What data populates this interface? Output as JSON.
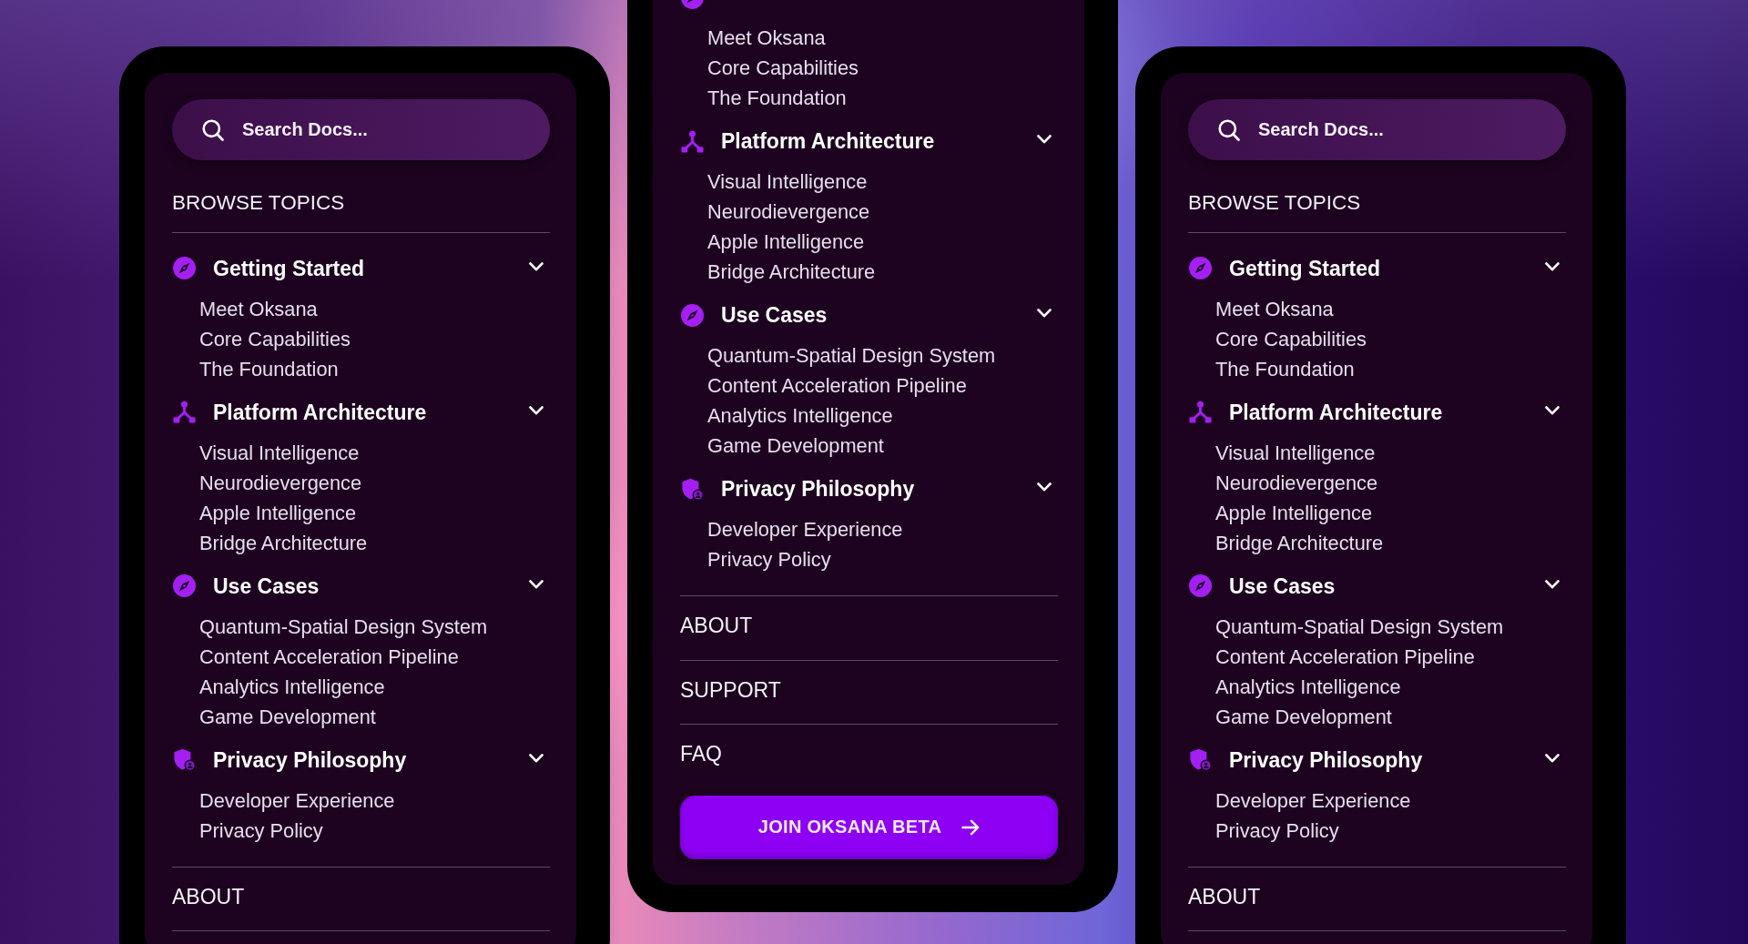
{
  "phones": [
    {
      "search": {
        "placeholder": "Search Docs..."
      },
      "section_title": "BROWSE TOPICS",
      "topics": [
        {
          "kind": "compass",
          "label": "Getting Started",
          "items": [
            "Meet Oksana",
            "Core Capabilities",
            "The Foundation"
          ]
        },
        {
          "kind": "network",
          "label": "Platform Architecture",
          "items": [
            "Visual Intelligence",
            "Neurodievergence",
            "Apple Intelligence",
            "Bridge Architecture"
          ]
        },
        {
          "kind": "compass",
          "label": "Use Cases",
          "items": [
            "Quantum-Spatial Design System",
            "Content Acceleration Pipeline",
            "Analytics Intelligence",
            "Game Development"
          ]
        },
        {
          "kind": "shield",
          "label": "Privacy Philosophy",
          "items": [
            "Developer Experience",
            "Privacy Policy"
          ]
        }
      ],
      "links": [
        "ABOUT"
      ]
    },
    {
      "topics": [
        {
          "kind": "compass",
          "items": [
            "Meet Oksana",
            "Core Capabilities",
            "The Foundation"
          ]
        },
        {
          "kind": "network",
          "label": "Platform Architecture",
          "items": [
            "Visual Intelligence",
            "Neurodievergence",
            "Apple Intelligence",
            "Bridge Architecture"
          ]
        },
        {
          "kind": "compass",
          "label": "Use Cases",
          "items": [
            "Quantum-Spatial Design System",
            "Content Acceleration Pipeline",
            "Analytics Intelligence",
            "Game Development"
          ]
        },
        {
          "kind": "shield",
          "label": "Privacy Philosophy",
          "items": [
            "Developer Experience",
            "Privacy Policy"
          ]
        }
      ],
      "links": [
        "ABOUT",
        "SUPPORT",
        "FAQ"
      ],
      "cta": {
        "label": "JOIN OKSANA BETA"
      }
    },
    {
      "search": {
        "placeholder": "Search Docs..."
      },
      "section_title": "BROWSE TOPICS",
      "topics": [
        {
          "kind": "compass",
          "label": "Getting Started",
          "items": [
            "Meet Oksana",
            "Core Capabilities",
            "The Foundation"
          ]
        },
        {
          "kind": "network",
          "label": "Platform Architecture",
          "items": [
            "Visual Intelligence",
            "Neurodievergence",
            "Apple Intelligence",
            "Bridge Architecture"
          ]
        },
        {
          "kind": "compass",
          "label": "Use Cases",
          "items": [
            "Quantum-Spatial Design System",
            "Content Acceleration Pipeline",
            "Analytics Intelligence",
            "Game Development"
          ]
        },
        {
          "kind": "shield",
          "label": "Privacy Philosophy",
          "items": [
            "Developer Experience",
            "Privacy Policy"
          ]
        }
      ],
      "links": [
        "ABOUT"
      ]
    }
  ]
}
